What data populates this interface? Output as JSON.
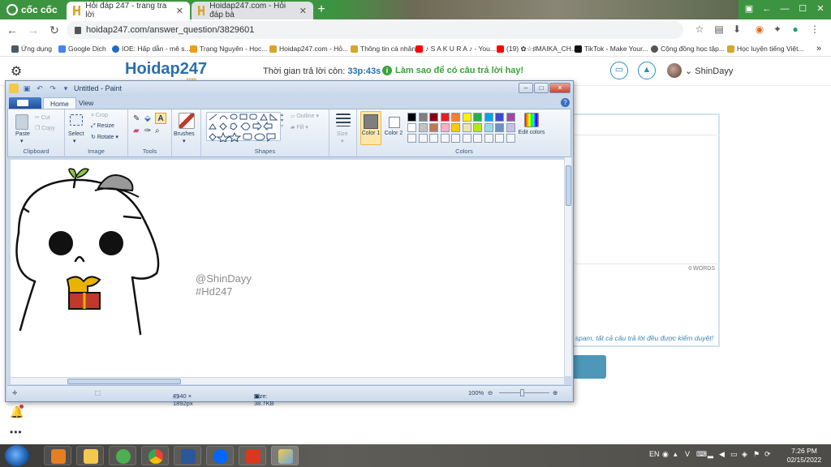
{
  "browser": {
    "brand": "cốc cốc",
    "tabs": [
      {
        "title": "Hỏi đáp 247 - trang tra lời",
        "active": true
      },
      {
        "title": "Hoidap247.com - Hỏi đáp bà",
        "active": false
      }
    ],
    "url": "hoidap247.com/answer_question/3829601",
    "bookmarks": [
      "Ứng dụng",
      "Google Dịch",
      "IOE: Hấp dẫn - mê s...",
      "Trạng Nguyên - Học...",
      "Hoidap247.com - Hỏ...",
      "Thông tin cá nhân",
      "♪ S A K U R A ♪ - You...",
      "(19) ✿☆♯MAIKA_CH...",
      "TikTok - Make Your...",
      "Cộng đồng học tập...",
      "Học luyện tiếng Việt..."
    ]
  },
  "site": {
    "logo_main": "Hoidap247",
    "logo_sub": ".com",
    "timer_label": "Thời gian trả lời còn:",
    "timer_value": "33p:43s",
    "help_link": "Làm sao để có câu trả lời hay!",
    "username": "ShinDayy",
    "word_count": "0 WORDS",
    "notice": "spam, tất cả câu trả lời đều được kiểm duyệt!"
  },
  "paint": {
    "title": "Untitled - Paint",
    "tabs": [
      "Home",
      "View"
    ],
    "clipboard": {
      "paste": "Paste",
      "cut": "Cut",
      "copy": "Copy",
      "label": "Clipboard"
    },
    "image": {
      "select": "Select",
      "crop": "Crop",
      "resize": "Resize",
      "rotate": "Rotate",
      "label": "Image"
    },
    "tools_label": "Tools",
    "brushes": "Brushes",
    "shapes": {
      "outline": "Outline",
      "fill": "Fill",
      "label": "Shapes"
    },
    "size": "Size",
    "color1": "Color 1",
    "color2": "Color 2",
    "edit_colors": "Edit colors",
    "colors_label": "Colors",
    "palette_row1": [
      "#000000",
      "#7f7f7f",
      "#880015",
      "#ed1c24",
      "#ff7f27",
      "#fff200",
      "#22b14c",
      "#00a2e8",
      "#3f48cc",
      "#a349a4"
    ],
    "palette_row2": [
      "#ffffff",
      "#c3c3c3",
      "#b97a57",
      "#ffaec9",
      "#ffc90e",
      "#efe4b0",
      "#b5e61d",
      "#99d9ea",
      "#7092be",
      "#c8bfe7"
    ],
    "watermark_line1": "@ShinDayy",
    "watermark_line2": "#Hd247",
    "status": {
      "dimensions": "4940 × 1892px",
      "size": "Size: 38.7KB",
      "zoom": "100%"
    }
  },
  "taskbar": {
    "lang": "EN",
    "time": "7:26 PM",
    "date": "02/15/2022"
  }
}
